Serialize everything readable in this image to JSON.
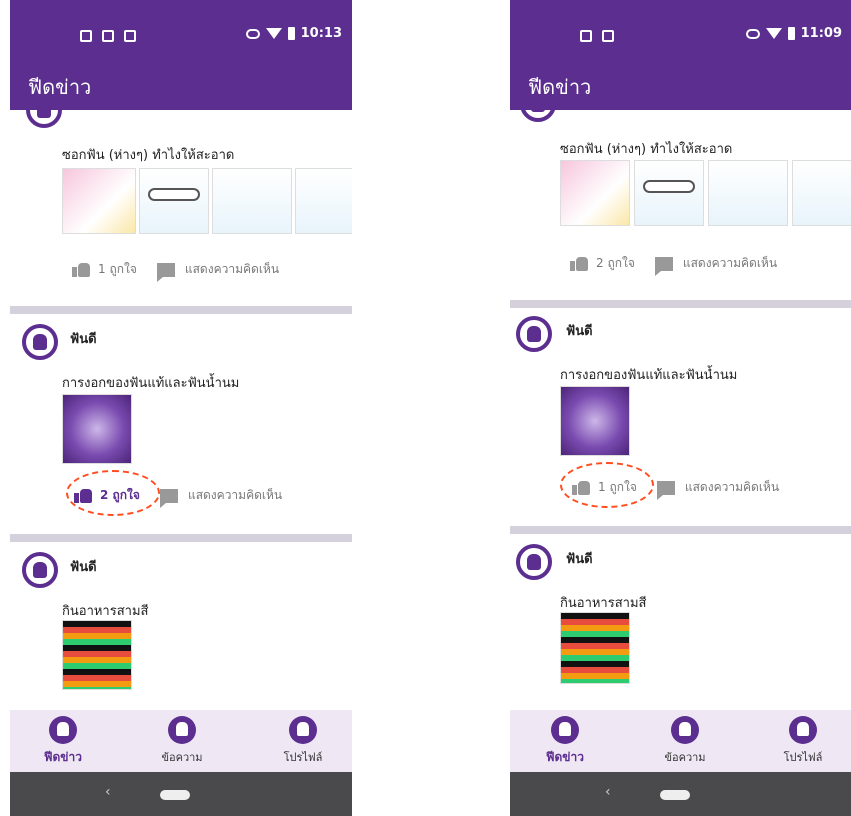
{
  "left": {
    "status_time": "10:13",
    "appbar_title": "ฟีดข่าว",
    "posts": [
      {
        "text": "ซอกฟัน (ห่างๆ) ทำไงให้สะอาด",
        "like_label": "1 ถูกใจ",
        "comment_label": "แสดงความคิดเห็น"
      },
      {
        "author": "ฟันดี",
        "text": "การงอกของฟันแท้และฟันน้ำนม",
        "like_label": "2 ถูกใจ",
        "comment_label": "แสดงความคิดเห็น"
      },
      {
        "author": "ฟันดี",
        "text": "กินอาหารสามสี"
      }
    ],
    "nav": [
      {
        "label": "ฟีดข่าว",
        "icon": "tooth-icon"
      },
      {
        "label": "ข้อความ",
        "icon": "tooth-icon"
      },
      {
        "label": "โปรไฟล์",
        "icon": "tooth-icon"
      }
    ]
  },
  "right": {
    "status_time": "11:09",
    "appbar_title": "ฟีดข่าว",
    "posts": [
      {
        "text": "ซอกฟัน (ห่างๆ) ทำไงให้สะอาด",
        "like_label": "2 ถูกใจ",
        "comment_label": "แสดงความคิดเห็น"
      },
      {
        "author": "ฟันดี",
        "text": "การงอกของฟันแท้และฟันน้ำนม",
        "like_label": "1 ถูกใจ",
        "comment_label": "แสดงความคิดเห็น"
      },
      {
        "author": "ฟันดี",
        "text": "กินอาหารสามสี"
      }
    ],
    "nav": [
      {
        "label": "ฟีดข่าว",
        "icon": "tooth-icon"
      },
      {
        "label": "ข้อความ",
        "icon": "tooth-icon"
      },
      {
        "label": "โปรไฟล์",
        "icon": "tooth-icon"
      }
    ]
  },
  "colors": {
    "primary": "#5b2e8f",
    "highlight": "#ff4d1f",
    "nav_bg": "#efe7f4",
    "divider": "#d4d1dc"
  }
}
